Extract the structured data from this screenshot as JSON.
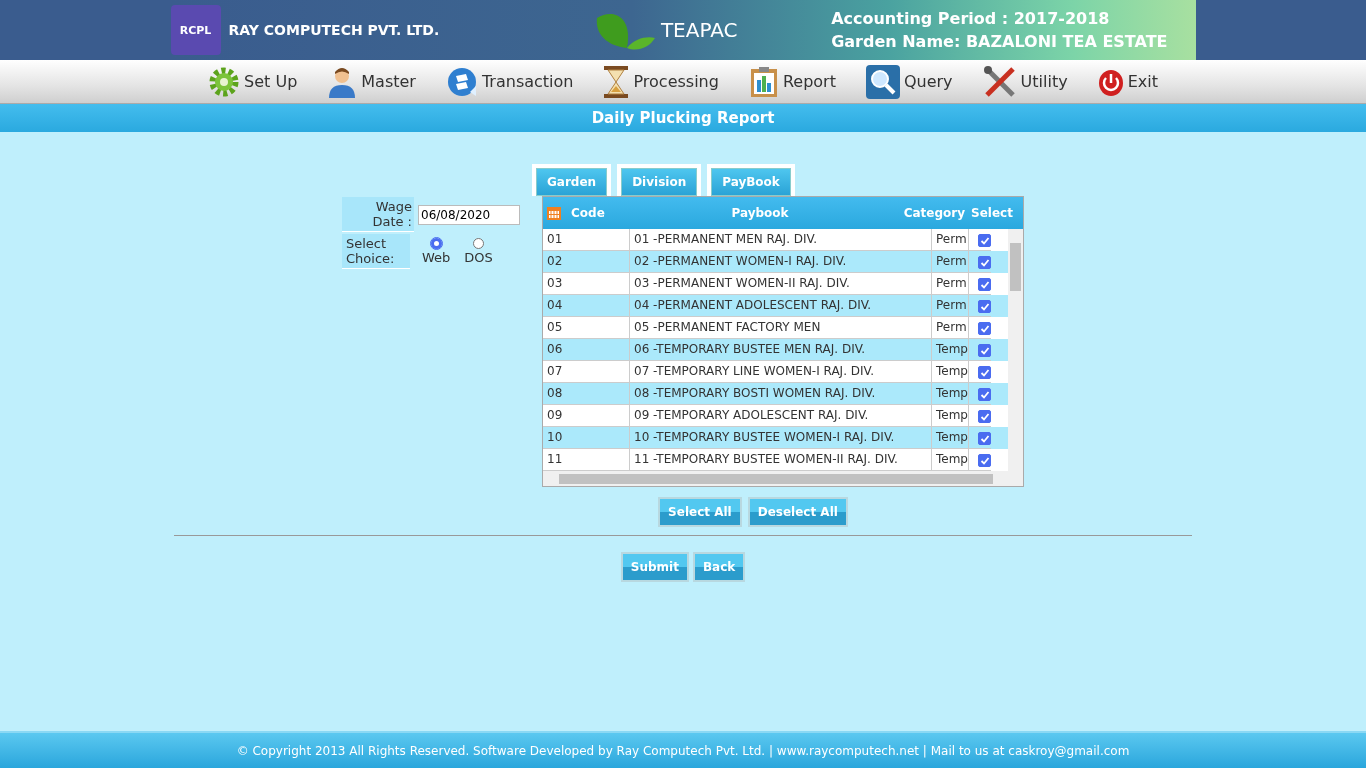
{
  "header": {
    "company": "RAY COMPUTECH PVT. LTD.",
    "logo_text": "RCPL",
    "app_name": "TEAPAC",
    "accounting_period": "Accounting Period : 2017-2018",
    "garden_name": "Garden Name: BAZALONI TEA ESTATE"
  },
  "menu": [
    {
      "label": "Set Up",
      "kind": "gear"
    },
    {
      "label": "Master",
      "kind": "person"
    },
    {
      "label": "Transaction",
      "kind": "transaction"
    },
    {
      "label": "Processing",
      "kind": "hourglass"
    },
    {
      "label": "Report",
      "kind": "report"
    },
    {
      "label": "Query",
      "kind": "search"
    },
    {
      "label": "Utility",
      "kind": "tools"
    },
    {
      "label": "Exit",
      "kind": "power"
    }
  ],
  "page_title": "Daily Plucking Report",
  "form": {
    "wage_date_label": "Wage Date :",
    "wage_date": "06/08/2020",
    "choice_label": "Select Choice:",
    "choices": [
      {
        "label": "Web",
        "selected": true
      },
      {
        "label": "DOS",
        "selected": false
      }
    ]
  },
  "tabs": [
    {
      "label": "Garden",
      "selected": false
    },
    {
      "label": "Division",
      "selected": false
    },
    {
      "label": "PayBook",
      "selected": false
    }
  ],
  "table": {
    "columns": [
      "Code",
      "Paybook",
      "Category",
      "Select"
    ],
    "rows": [
      {
        "code": "01",
        "paybook": "01 -PERMANENT MEN RAJ. DIV.",
        "category": "Perm",
        "checked": true
      },
      {
        "code": "02",
        "paybook": "02 -PERMANENT WOMEN-I RAJ. DIV.",
        "category": "Perm",
        "checked": true
      },
      {
        "code": "03",
        "paybook": "03 -PERMANENT WOMEN-II RAJ. DIV.",
        "category": "Perm",
        "checked": true
      },
      {
        "code": "04",
        "paybook": "04 -PERMANENT ADOLESCENT RAJ. DIV.",
        "category": "Perm",
        "checked": true
      },
      {
        "code": "05",
        "paybook": "05 -PERMANENT FACTORY MEN",
        "category": "Perm",
        "checked": true
      },
      {
        "code": "06",
        "paybook": "06 -TEMPORARY BUSTEE MEN RAJ. DIV.",
        "category": "Temp",
        "checked": true
      },
      {
        "code": "07",
        "paybook": "07 -TEMPORARY LINE WOMEN-I RAJ. DIV.",
        "category": "Temp",
        "checked": true
      },
      {
        "code": "08",
        "paybook": "08 -TEMPORARY BOSTI WOMEN RAJ. DIV.",
        "category": "Temp",
        "checked": true
      },
      {
        "code": "09",
        "paybook": "09 -TEMPORARY ADOLESCENT RAJ. DIV.",
        "category": "Temp",
        "checked": true
      },
      {
        "code": "10",
        "paybook": "10 -TEMPORARY BUSTEE WOMEN-I RAJ. DIV.",
        "category": "Temp",
        "checked": true
      },
      {
        "code": "11",
        "paybook": "11 -TEMPORARY BUSTEE WOMEN-II RAJ. DIV.",
        "category": "Temp",
        "checked": true
      }
    ]
  },
  "select_buttons": [
    "Select All",
    "Deselect All"
  ],
  "action_buttons": [
    "Submit",
    "Back"
  ],
  "footer": "© Copyright 2013 All Rights Reserved. Software Developed by Ray Computech Pvt. Ltd. | www.raycomputech.net | Mail to us at caskroy@gmail.com"
}
